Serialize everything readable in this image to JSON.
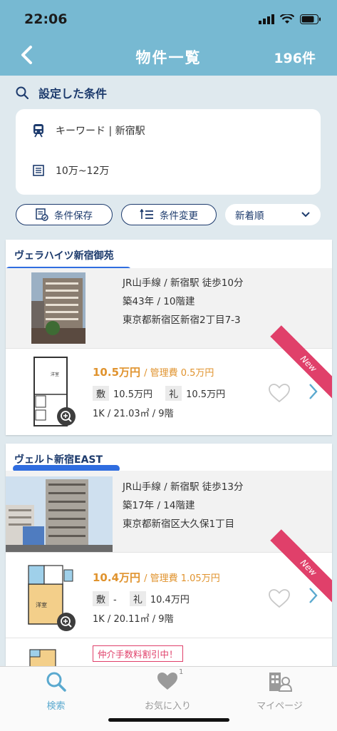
{
  "status": {
    "time": "22:06"
  },
  "nav": {
    "title": "物件一覧",
    "count": "196件"
  },
  "conditions": {
    "header": "設定した条件",
    "keyword": "キーワード | 新宿駅",
    "price": "10万~12万"
  },
  "actions": {
    "save": "条件保存",
    "change": "条件変更",
    "sort": "新着順"
  },
  "listings": [
    {
      "name": "ヴェラハイツ新宿御苑",
      "access": "JR山手線 / 新宿駅 徒歩10分",
      "age": "築43年 / 10階建",
      "address": "東京都新宿区新宿2丁目7-3",
      "rent": "10.5万円",
      "fee": "/ 管理費 0.5万円",
      "deposit_label": "敷",
      "deposit": "10.5万円",
      "key_label": "礼",
      "key_money": "10.5万円",
      "layout": "1K / 21.03㎡ / 9階",
      "badge": "New"
    },
    {
      "name": "ヴェルト新宿EAST",
      "access": "JR山手線 / 新宿駅 徒歩13分",
      "age": "築17年 / 14階建",
      "address": "東京都新宿区大久保1丁目",
      "rent": "10.4万円",
      "fee": "/ 管理費 1.05万円",
      "deposit_label": "敷",
      "deposit": "-",
      "key_label": "礼",
      "key_money": "10.4万円",
      "layout": "1K / 20.11㎡ / 9階",
      "badge": "New",
      "promo": "仲介手数料割引中！"
    }
  ],
  "tabs": [
    {
      "label": "検索",
      "icon": "search-icon",
      "active": true
    },
    {
      "label": "お気に入り",
      "icon": "heart-icon",
      "badge": "1"
    },
    {
      "label": "マイページ",
      "icon": "mypage-icon"
    }
  ],
  "colors": {
    "header": "#77b9d2",
    "navy": "#1d3b6d",
    "price": "#e0932e",
    "new": "#e0406a",
    "active_tab": "#5aa9cf"
  }
}
